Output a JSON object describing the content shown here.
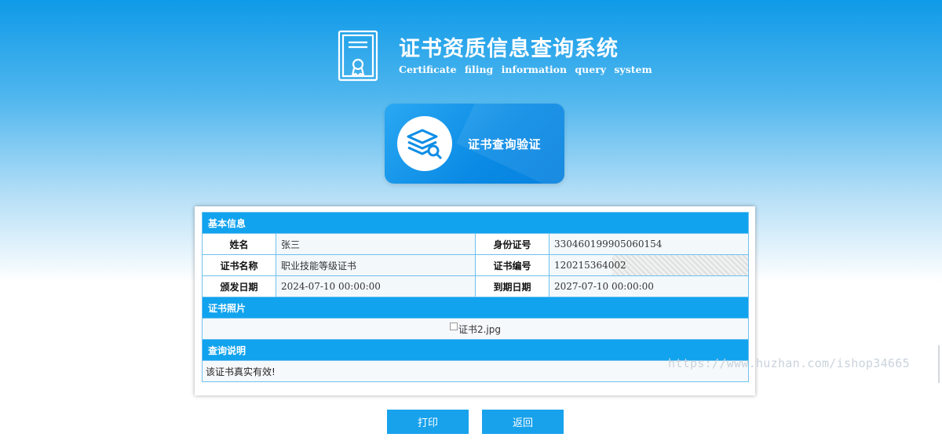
{
  "header": {
    "title": "证书资质信息查询系统",
    "subtitle": "Certificate filing information query system"
  },
  "query_card": {
    "label": "证书查询验证"
  },
  "sections": {
    "basic": "基本信息",
    "photo": "证书照片",
    "note": "查询说明"
  },
  "fields": {
    "name_label": "姓名",
    "name_value": "张三",
    "id_label": "身份证号",
    "id_value": "330460199905060154",
    "cert_name_label": "证书名称",
    "cert_name_value": "职业技能等级证书",
    "cert_no_label": "证书编号",
    "cert_no_value": "120215364002",
    "issue_date_label": "颁发日期",
    "issue_date_value": "2024-07-10 00:00:00",
    "expire_date_label": "到期日期",
    "expire_date_value": "2027-07-10 00:00:00"
  },
  "photo": {
    "alt_text": "证书2.jpg"
  },
  "note": {
    "text": "该证书真实有效!"
  },
  "buttons": {
    "print": "打印",
    "back": "返回"
  },
  "watermark": "https://www.huzhan.com/ishop34665",
  "colors": {
    "primary": "#11a3ee",
    "border": "#6fc1ee",
    "button": "#18a2ec"
  },
  "icons": {
    "logo": "certificate-icon",
    "query": "layers-search-icon"
  }
}
